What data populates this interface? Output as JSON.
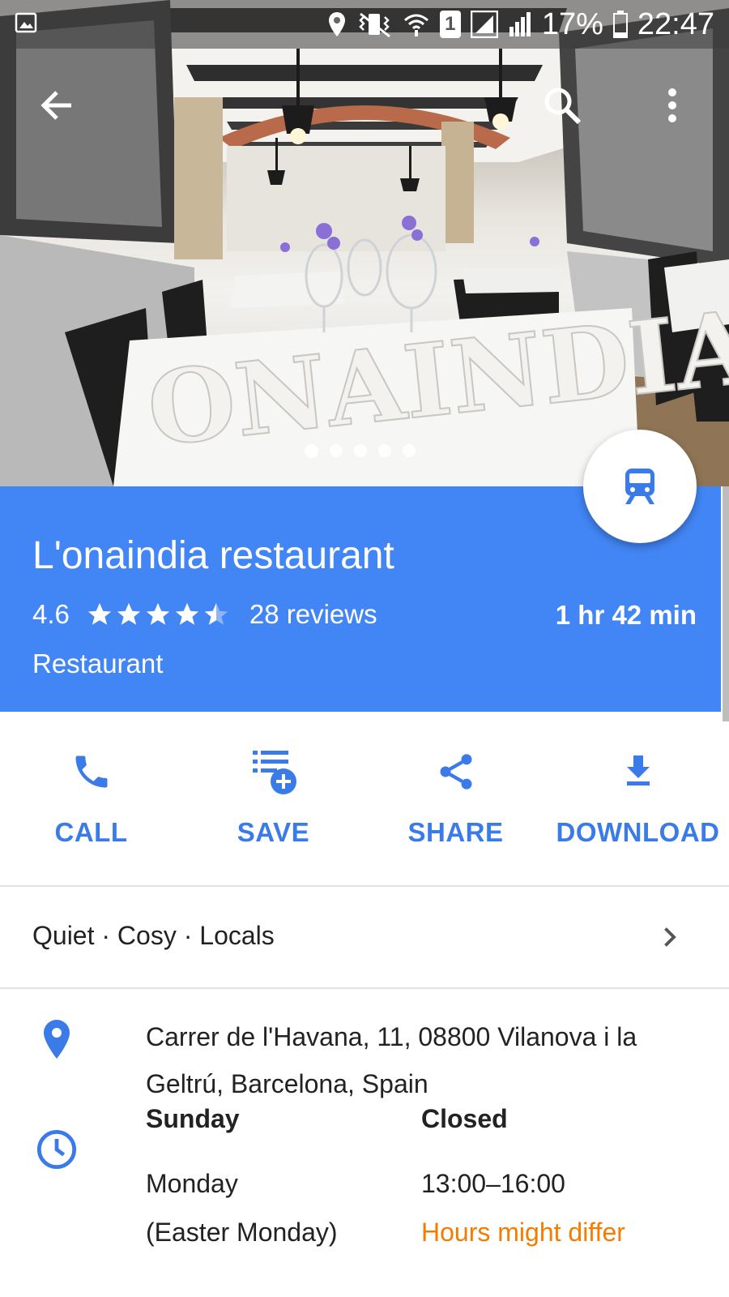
{
  "status_bar": {
    "battery_percent": "17%",
    "time": "22:47",
    "sim_slot": "1"
  },
  "toolbar": {
    "back_icon": "arrow-back-icon",
    "search_icon": "search-icon",
    "more_icon": "more-vert-icon"
  },
  "photo": {
    "sign_text": "ONAINDIA",
    "page_count": 5,
    "active_page": 1
  },
  "place": {
    "name": "L'onaindia restaurant",
    "rating": "4.6",
    "stars": 4.5,
    "reviews": "28 reviews",
    "travel_time": "1 hr 42 min",
    "category": "Restaurant",
    "transit_icon": "train-icon"
  },
  "actions": [
    {
      "label": "CALL",
      "icon": "phone-icon"
    },
    {
      "label": "SAVE",
      "icon": "save-to-list-icon"
    },
    {
      "label": "SHARE",
      "icon": "share-icon"
    },
    {
      "label": "DOWNLOAD",
      "icon": "download-icon"
    }
  ],
  "atmosphere": "Quiet · Cosy · Locals",
  "address": "Carrer de l'Havana, 11, 08800 Vilanova i la Geltrú, Barcelona, Spain",
  "hours": [
    {
      "day": "Sunday",
      "value": "Closed"
    },
    {
      "day": "Monday",
      "note": "(Easter Monday)",
      "value": "13:00–16:00",
      "warning": "Hours might differ"
    }
  ],
  "colors": {
    "accent": "#4285f4",
    "action_text": "#3b7be8",
    "warning": "#f57c00"
  }
}
